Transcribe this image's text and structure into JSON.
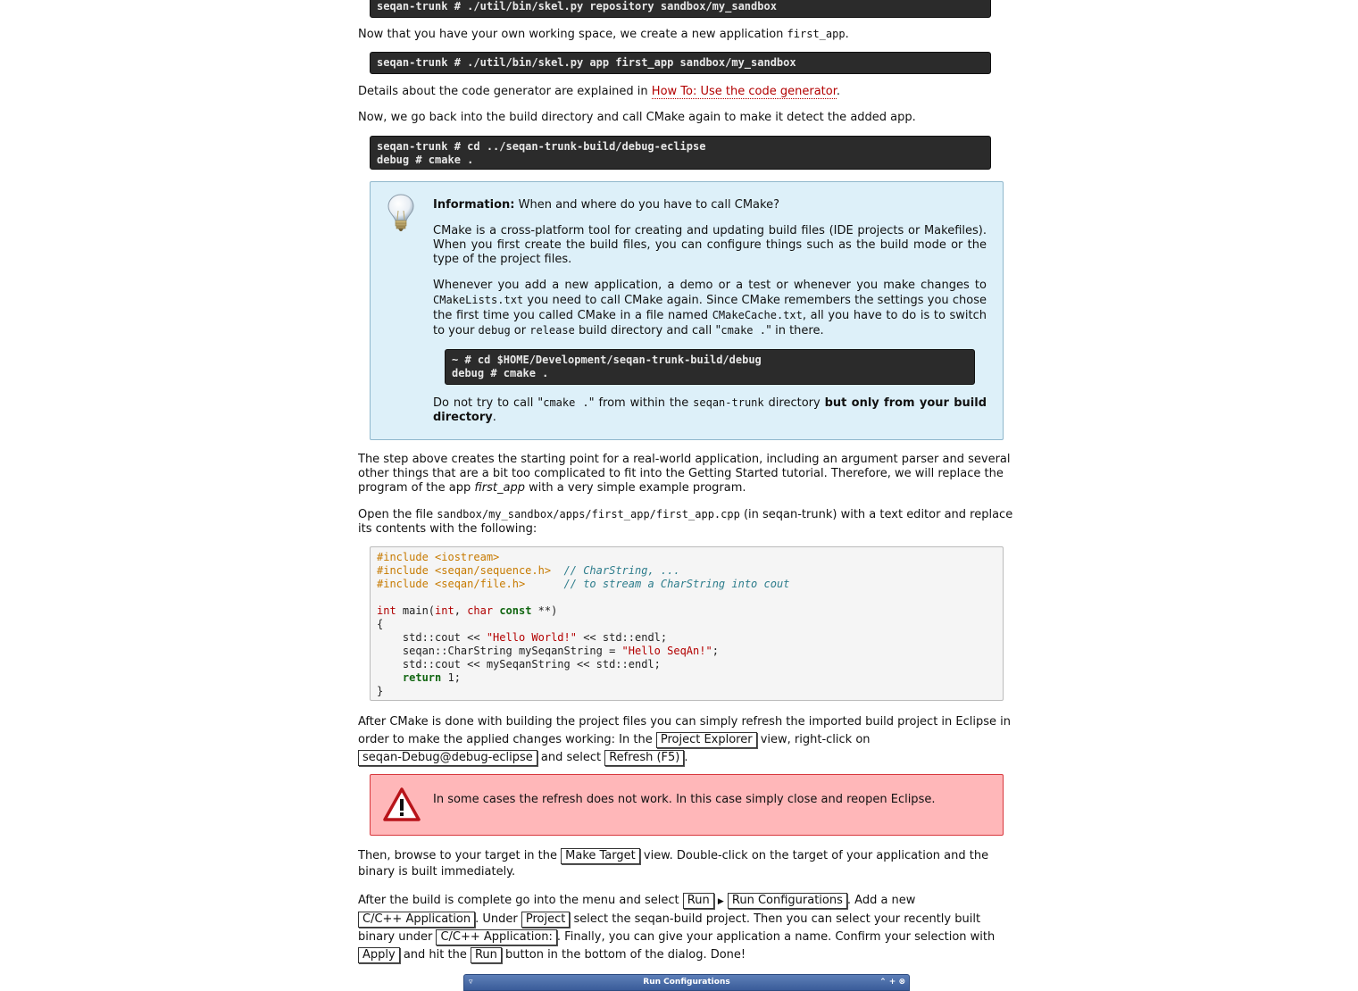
{
  "commands": {
    "skel_repo": "seqan-trunk # ./util/bin/skel.py repository sandbox/my_sandbox",
    "skel_app": "seqan-trunk # ./util/bin/skel.py app first_app sandbox/my_sandbox",
    "cmake_line1": "seqan-trunk # cd ../seqan-trunk-build/debug-eclipse",
    "cmake_line2": "debug # cmake ."
  },
  "para_working_space": {
    "text": "Now that you have your own working space, we create a new application ",
    "code": "first_app",
    "end": "."
  },
  "para_details": {
    "text": "Details about the code generator are explained in ",
    "link": "How To: Use the code generator",
    "end": "."
  },
  "para_build_dir": "Now, we go back into the build directory and call CMake again to make it detect the added app.",
  "info_box": {
    "label": "Information:",
    "title": " When and where do you have to call CMake?",
    "p1": "CMake is a cross-platform tool for creating and updating build files (IDE projects or Makefiles). When you first create the build files, you can configure things such as the build mode or the type of the project files.",
    "p2_a": "Whenever you add a new application, a demo or a test or whenever you make changes to ",
    "p2_code1": "CMakeLists.txt",
    "p2_b": " you need to call CMake again. Since CMake remembers the settings you chose the first time you called CMake in a file named ",
    "p2_code2": "CMakeCache.txt",
    "p2_c": ", all you have to do is to switch to your ",
    "p2_code3": "debug",
    "p2_d": " or ",
    "p2_code4": "release",
    "p2_e": " build directory and call \"",
    "p2_code5": "cmake .",
    "p2_f": "\" in there.",
    "term_line1": "~ # cd $HOME/Development/seqan-trunk-build/debug",
    "term_line2": "debug # cmake .",
    "p3_a": "Do not try to call \"",
    "p3_code1": "cmake .",
    "p3_b": "\" from within the ",
    "p3_code2": "seqan-trunk",
    "p3_c": " directory ",
    "p3_bold": "but only from your build directory",
    "p3_end": "."
  },
  "para_step_above": {
    "text": "The step above creates the starting point for a real-world application, including an argument parser and several other things that are a bit too complicated to fit into the Getting Started tutorial. Therefore, we will replace the program of the app ",
    "em": "first_app",
    "end": " with a very simple example program."
  },
  "para_open_file": {
    "text": "Open the file ",
    "code": "sandbox/my_sandbox/apps/first_app/first_app.cpp",
    "end": " (in seqan-trunk) with a text editor and replace its contents with the following:"
  },
  "code_sample": {
    "inc1": "#include <iostream>",
    "inc2": "#include <seqan/sequence.h>",
    "cmt2": "// CharString, ...",
    "inc3": "#include <seqan/file.h>",
    "cmt3": "// to stream a CharString into cout",
    "int_kw": "int",
    "main": " main(",
    "int_kw2": "int",
    "comma": ", ",
    "char_kw": "char",
    "const_kw": "const",
    "main_end": " **)",
    "open_brace": "{",
    "l1a": "    std::cout << ",
    "l1s": "\"Hello World!\"",
    "l1b": " << std::endl;",
    "l2a": "    seqan::CharString mySeqanString = ",
    "l2s": "\"Hello SeqAn!\"",
    "l2b": ";",
    "l3": "    std::cout << mySeqanString << std::endl;",
    "ret_kw": "return",
    "ret_val": " 1;",
    "close_brace": "}"
  },
  "para_after_cmake": {
    "a": "After CMake is done with building the project files you can simply refresh the imported build project in Eclipse in order to make the applied changes working: In the ",
    "gui1": "Project Explorer",
    "b": " view, right-click on ",
    "gui2": "seqan-Debug@debug-eclipse",
    "c": " and select ",
    "gui3": "Refresh (F5)",
    "end": "."
  },
  "warning_text": "In some cases the refresh does not work. In this case simply close and reopen Eclipse.",
  "para_make_target": {
    "a": "Then, browse to your target in the ",
    "gui1": "Make Target",
    "b": " view. Double-click on the target of your application and the binary is built immediately."
  },
  "para_run": {
    "a": "After the build is complete go into the menu and select ",
    "gui_run": "Run",
    "gui_run_conf": "Run Configurations",
    "b": ". Add a new ",
    "gui_cpp_app": "C/C++ Application",
    "c": ". Under ",
    "gui_project": "Project",
    "d": " select the seqan-build project. Then you can select your recently built binary under ",
    "gui_cpp_app2": "C/C++ Application:",
    "e": ". Finally, you can give your application a name. Confirm your selection with ",
    "gui_apply": "Apply",
    "f": " and hit the ",
    "gui_run2": "Run",
    "g": " button in the bottom of the dialog. Done!"
  },
  "dialog_title": "Run Configurations"
}
